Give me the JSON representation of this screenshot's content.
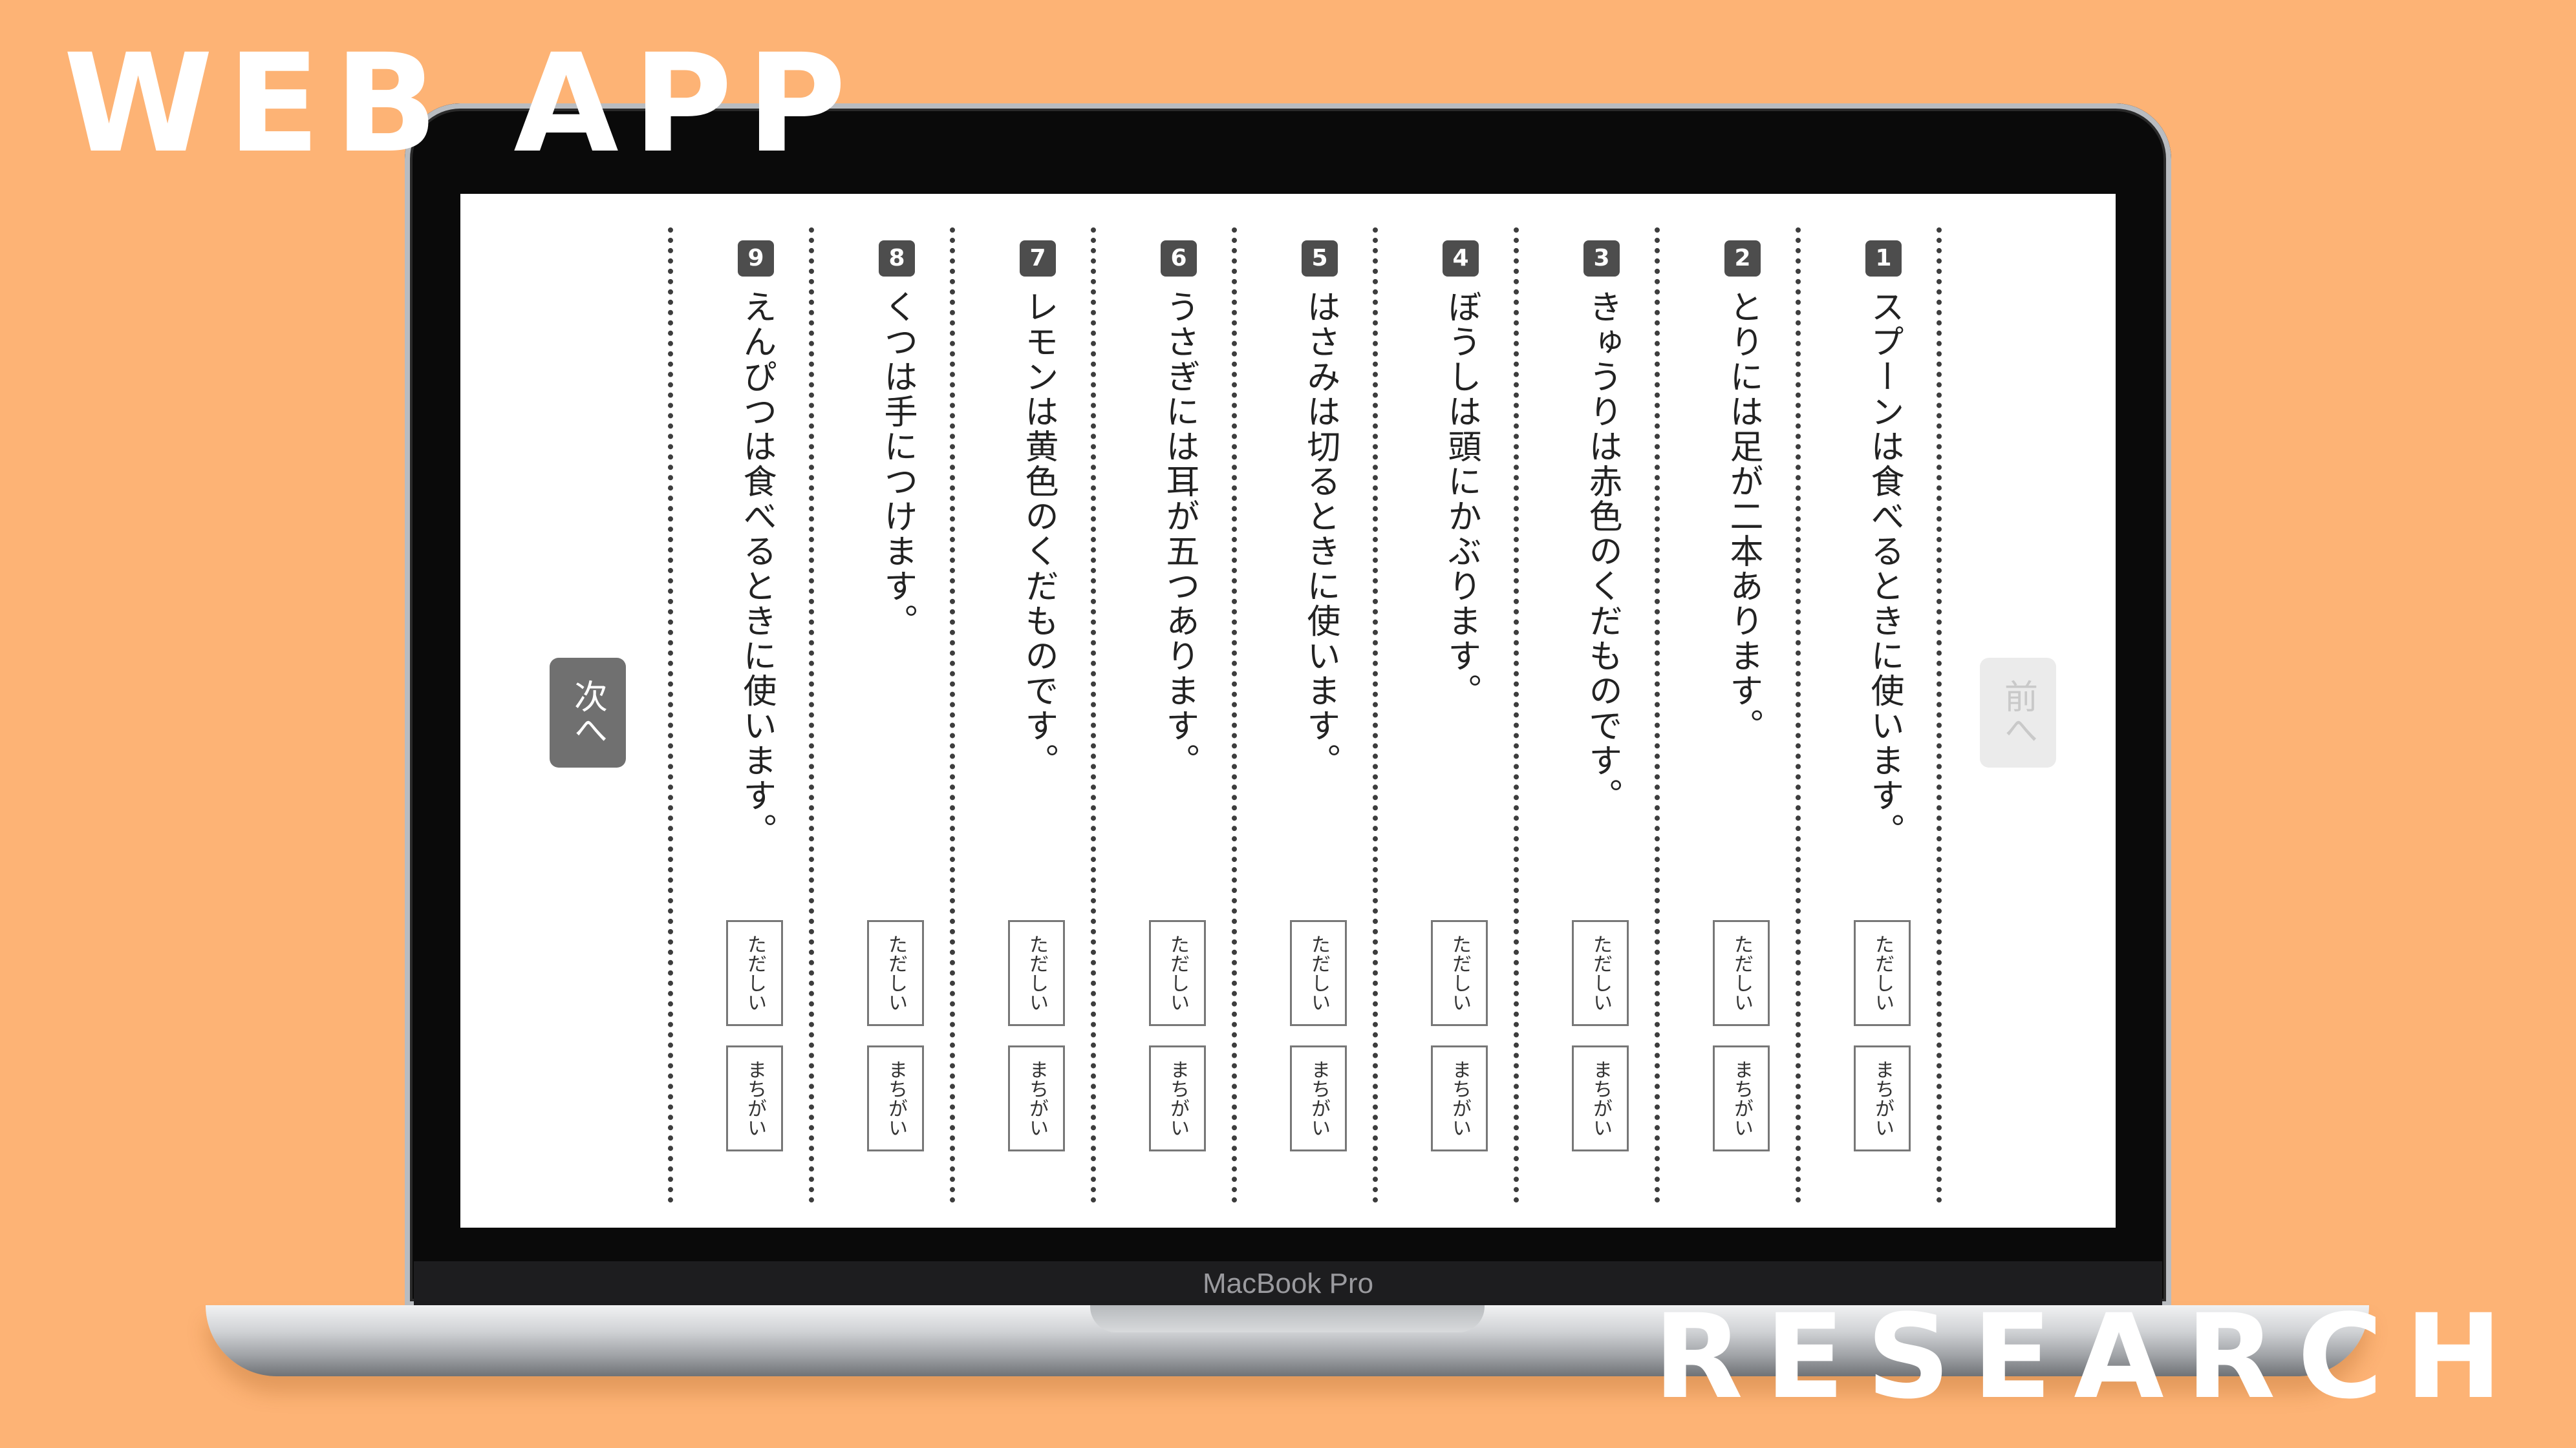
{
  "banner": {
    "top": "WEB APP",
    "bottom": "RESEARCH"
  },
  "laptop": {
    "brand": "MacBook Pro"
  },
  "nav": {
    "next_label": "次へ",
    "prev_label": "前へ"
  },
  "answer_labels": {
    "correct": "ただしい",
    "wrong": "まちがい"
  },
  "questions": [
    {
      "number": "1",
      "text": "スプーンは食べるときに使います。"
    },
    {
      "number": "2",
      "text": "とりには足が二本あります。"
    },
    {
      "number": "3",
      "text": "きゅうりは赤色のくだものです。"
    },
    {
      "number": "4",
      "text": "ぼうしは頭にかぶります。"
    },
    {
      "number": "5",
      "text": "はさみは切るときに使います。"
    },
    {
      "number": "6",
      "text": "うさぎには耳が五つあります。"
    },
    {
      "number": "7",
      "text": "レモンは黄色のくだものです。"
    },
    {
      "number": "8",
      "text": "くつは手につけます。"
    },
    {
      "number": "9",
      "text": "えんぴつは食べるときに使います。"
    }
  ],
  "colors": {
    "background": "#fdb375",
    "next_button": "#707070",
    "prev_button_disabled": "#ebebeb"
  }
}
